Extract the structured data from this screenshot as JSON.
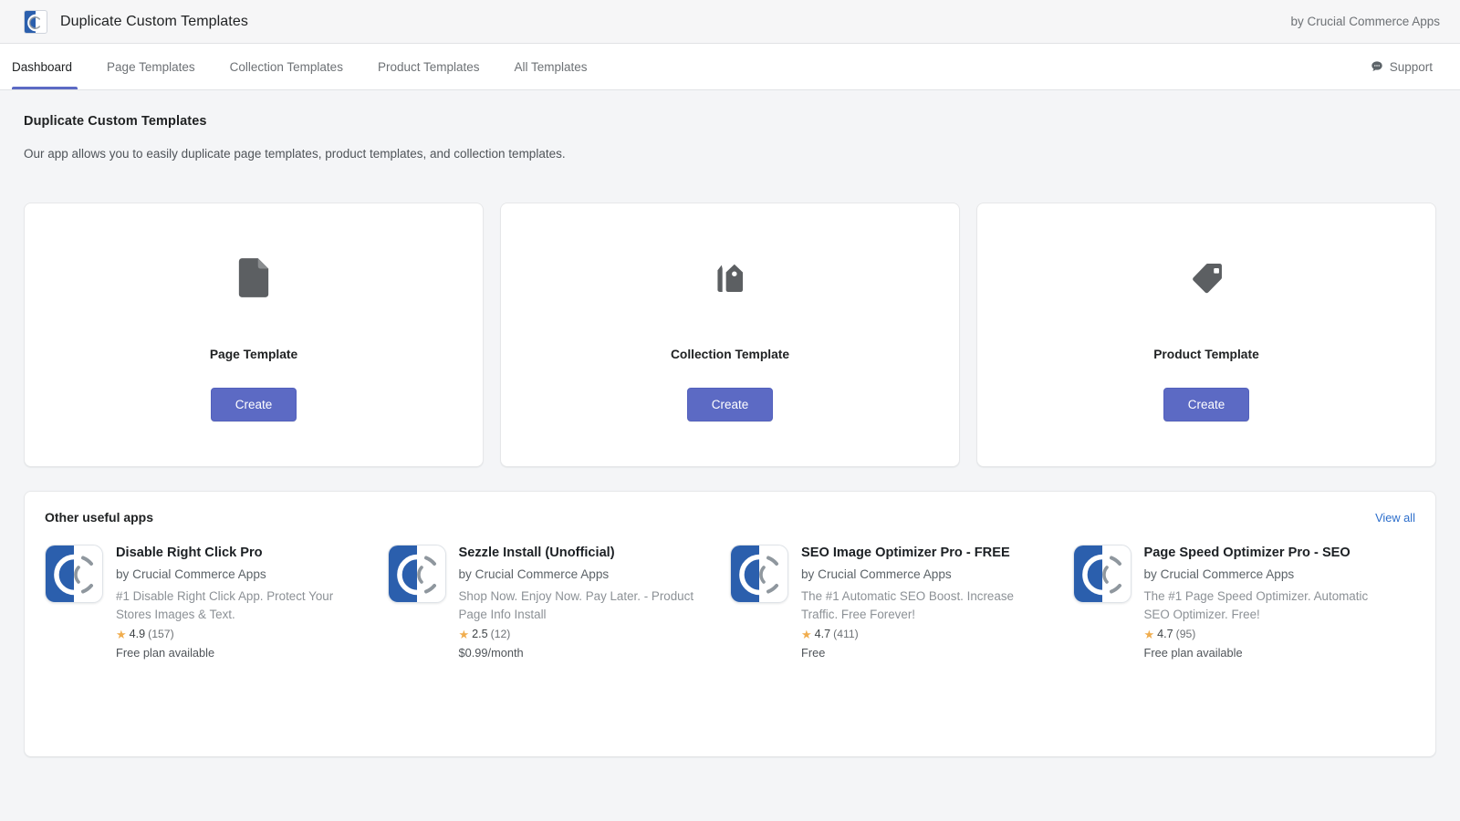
{
  "topbar": {
    "app_title": "Duplicate Custom Templates",
    "vendor": "by Crucial Commerce Apps",
    "logo_icon": "crucial-commerce-c-logo"
  },
  "tabbar": {
    "tabs": [
      {
        "label": "Dashboard",
        "active": true
      },
      {
        "label": "Page Templates",
        "active": false
      },
      {
        "label": "Collection Templates",
        "active": false
      },
      {
        "label": "Product Templates",
        "active": false
      },
      {
        "label": "All Templates",
        "active": false
      }
    ],
    "support_label": "Support",
    "support_icon": "chat-bubble-icon",
    "active_underline_color": "#5c6ac4"
  },
  "main": {
    "heading": "Duplicate Custom Templates",
    "subheading": "Our app allows you to easily duplicate page templates, product templates, and collection templates.",
    "template_cards": [
      {
        "title": "Page Template",
        "button_label": "Create",
        "icon": "page-document-icon"
      },
      {
        "title": "Collection Template",
        "button_label": "Create",
        "icon": "collection-tags-icon"
      },
      {
        "title": "Product Template",
        "button_label": "Create",
        "icon": "product-tag-icon"
      }
    ],
    "button_color": "#5c6ac4"
  },
  "other_apps": {
    "title": "Other useful apps",
    "view_all_label": "View all",
    "view_all_color": "#2c6ecb",
    "items": [
      {
        "name": "Disable Right Click Pro",
        "vendor": "by Crucial Commerce Apps",
        "description": "#1 Disable Right Click App. Protect Your Stores Images & Text.",
        "rating": "4.9",
        "rating_count": "(157)",
        "price": "Free plan available",
        "logo_icon": "crucial-commerce-c-logo"
      },
      {
        "name": "Sezzle Install (Unofficial)",
        "vendor": "by Crucial Commerce Apps",
        "description": "Shop Now. Enjoy Now. Pay Later. - Product Page Info Install",
        "rating": "2.5",
        "rating_count": "(12)",
        "price": "$0.99/month",
        "logo_icon": "crucial-commerce-c-logo"
      },
      {
        "name": "SEO Image Optimizer Pro - FREE",
        "vendor": "by Crucial Commerce Apps",
        "description": "The #1 Automatic SEO Boost. Increase Traffic. Free Forever!",
        "rating": "4.7",
        "rating_count": "(411)",
        "price": "Free",
        "logo_icon": "crucial-commerce-c-logo"
      },
      {
        "name": "Page Speed Optimizer Pro - SEO",
        "vendor": "by Crucial Commerce Apps",
        "description": "The #1 Page Speed Optimizer. Automatic SEO Optimizer. Free!",
        "rating": "4.7",
        "rating_count": "(95)",
        "price": "Free plan available",
        "logo_icon": "crucial-commerce-c-logo"
      }
    ],
    "star_glyph": "★",
    "star_color": "#f0ad4e"
  }
}
